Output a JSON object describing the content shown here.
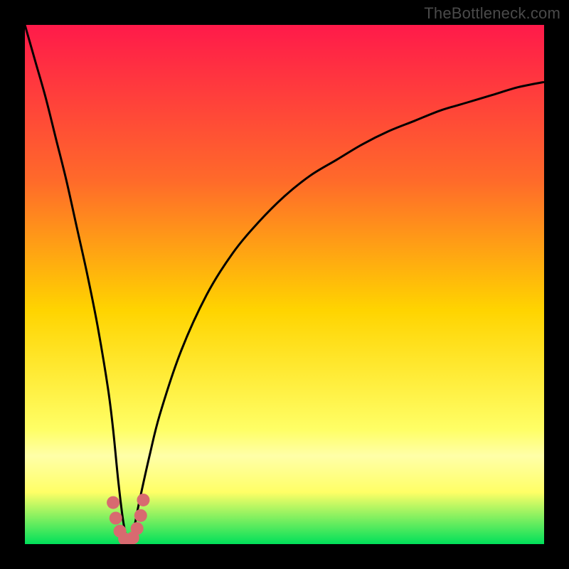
{
  "watermark": {
    "text": "TheBottleneck.com"
  },
  "colors": {
    "gradient_top": "#ff1a4a",
    "gradient_mid1": "#ff6a2a",
    "gradient_mid2": "#ffd400",
    "gradient_low": "#ffff66",
    "gradient_band": "#ffffa8",
    "gradient_bottom": "#00e05a",
    "curve": "#000000",
    "marker": "#d86a70"
  },
  "chart_data": {
    "type": "line",
    "title": "",
    "xlabel": "",
    "ylabel": "",
    "xlim": [
      0,
      100
    ],
    "ylim": [
      0,
      100
    ],
    "series": [
      {
        "name": "bottleneck-curve",
        "x": [
          0,
          2,
          4,
          6,
          8,
          10,
          12,
          14,
          16,
          17,
          18,
          19,
          20,
          21,
          22,
          24,
          26,
          30,
          35,
          40,
          45,
          50,
          55,
          60,
          65,
          70,
          75,
          80,
          85,
          90,
          95,
          100
        ],
        "y": [
          100,
          93,
          86,
          78,
          70,
          61,
          52,
          42,
          30,
          22,
          12,
          4,
          0,
          3,
          8,
          17,
          25,
          37,
          48,
          56,
          62,
          67,
          71,
          74,
          77,
          79.5,
          81.5,
          83.5,
          85,
          86.5,
          88,
          89
        ]
      }
    ],
    "markers": {
      "name": "optimum-band",
      "x": [
        17.0,
        17.5,
        18.3,
        19.2,
        20.0,
        20.8,
        21.6,
        22.3,
        22.8
      ],
      "y": [
        8.0,
        5.0,
        2.5,
        1.0,
        0.5,
        1.2,
        3.0,
        5.5,
        8.5
      ]
    },
    "gradient_stops_pct": [
      0,
      30,
      55,
      78,
      83,
      90,
      100
    ]
  }
}
